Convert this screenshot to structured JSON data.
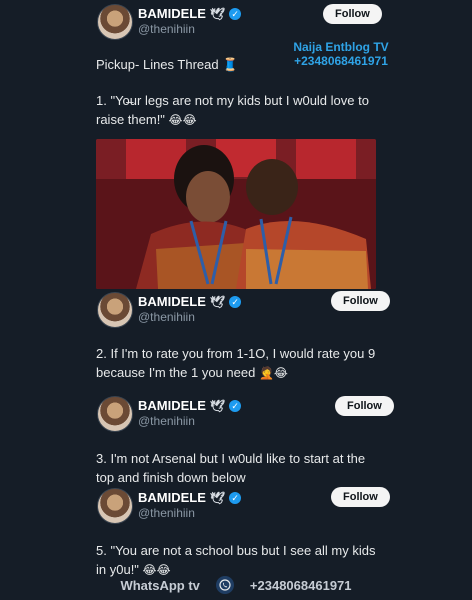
{
  "user": {
    "name": "BAMIDELE",
    "dove": "🕊",
    "verified": "✓",
    "handle": "@thenihiin",
    "follow_label": "Follow"
  },
  "watermark": {
    "line1": "Naija Entblog TV",
    "line2": "+2348068461971"
  },
  "thread_title": "Pickup- Lines Thread",
  "thread_title_icon": "🧵",
  "tweets": [
    {
      "text": "1. \"Yo̶ur legs are not my kids but I w0uld love to raise them!\"",
      "emoji": "😂😂"
    },
    {
      "text": "2. If I'm to rate you from 1-1O, I would rate you 9 because I'm the 1 you need",
      "emoji": "🤦😂"
    },
    {
      "text": "3. I'm not Arsenal but I w0uld like to start at the top and finish down below",
      "emoji": ""
    },
    {
      "text": "5. \"You are not a school bus but I see all my kids in y0u!\"",
      "emoji": "😂😂"
    }
  ],
  "footer": {
    "left": "WhatsApp tv",
    "right": "+2348068461971"
  },
  "colors": {
    "background": "#151d27",
    "verified": "#1d9bf0",
    "watermark": "#2fa3e6"
  }
}
